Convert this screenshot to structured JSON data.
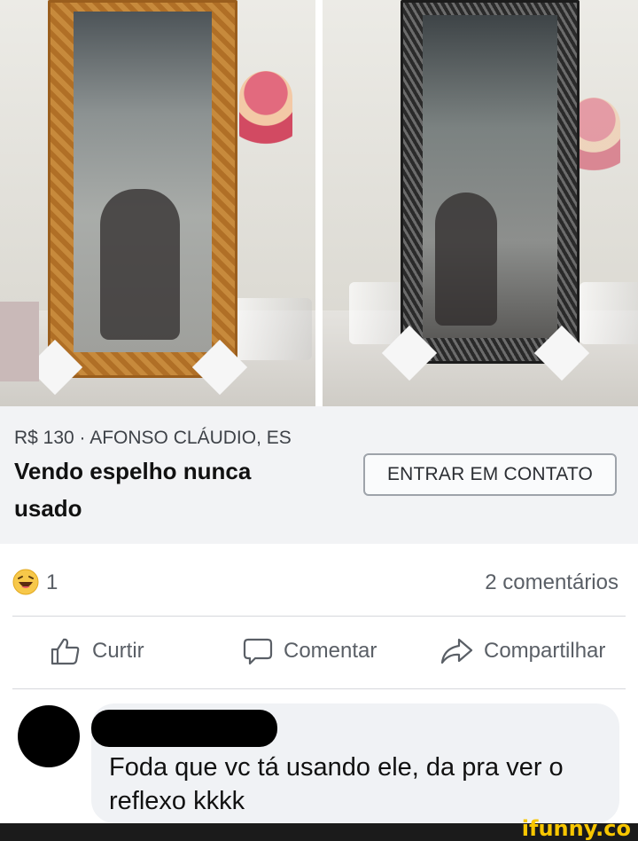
{
  "listing": {
    "price_location": "R$ 130 · AFONSO CLÁUDIO, ES",
    "title": "Vendo espelho nunca usado",
    "contact_button": "ENTRAR EM CONTATO"
  },
  "reactions": {
    "emoji": "laughing-emoji-icon",
    "count": "1",
    "comments": "2 comentários"
  },
  "actions": {
    "like": "Curtir",
    "comment": "Comentar",
    "share": "Compartilhar"
  },
  "comment": {
    "text": "Foda que vc tá usando ele, da pra ver o reflexo kkkk"
  },
  "watermark": "ifunny.co",
  "colors": {
    "text_gray": "#5a5f66",
    "listing_bg": "#f2f3f5",
    "bubble_bg": "#f0f2f5",
    "watermark_yellow": "#f7c600"
  }
}
